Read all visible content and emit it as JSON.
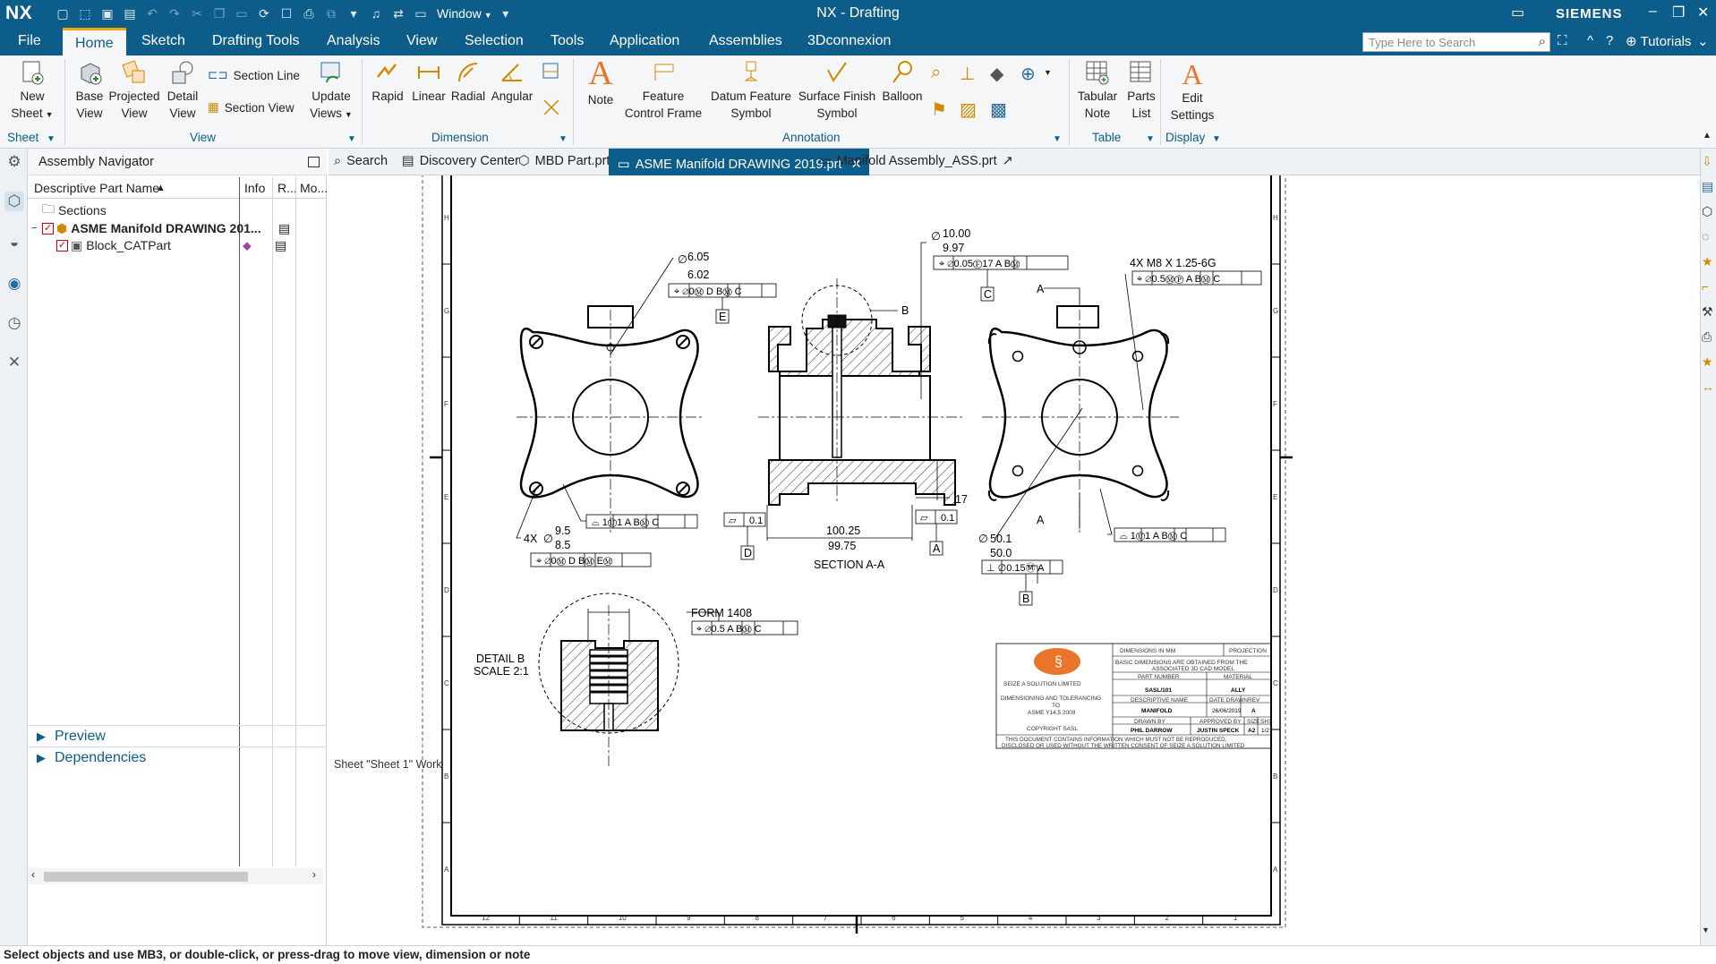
{
  "app": {
    "logo": "NX",
    "window_menu": "Window",
    "title": "NX - Drafting",
    "brand": "SIEMENS"
  },
  "ribbon_tabs": [
    "File",
    "Home",
    "Sketch",
    "Drafting Tools",
    "Analysis",
    "View",
    "Selection",
    "Tools",
    "Application",
    "Assemblies",
    "3Dconnexion"
  ],
  "search": {
    "placeholder": "Type Here to Search"
  },
  "tutorials": "Tutorials",
  "ribbon": {
    "sheet": {
      "new_sheet_1": "New",
      "new_sheet_2": "Sheet",
      "group": "Sheet"
    },
    "view": {
      "base_1": "Base",
      "base_2": "View",
      "projected_1": "Projected",
      "projected_2": "View",
      "detail_1": "Detail",
      "detail_2": "View",
      "section_line": "Section Line",
      "section_view": "Section View",
      "update_1": "Update",
      "update_2": "Views",
      "group": "View"
    },
    "dimension": {
      "rapid": "Rapid",
      "linear": "Linear",
      "radial": "Radial",
      "angular": "Angular",
      "group": "Dimension"
    },
    "annotation": {
      "note": "Note",
      "fcf_1": "Feature",
      "fcf_2": "Control Frame",
      "datum_1": "Datum Feature",
      "datum_2": "Symbol",
      "surface_1": "Surface Finish",
      "surface_2": "Symbol",
      "balloon": "Balloon",
      "group": "Annotation"
    },
    "table": {
      "tabular_1": "Tabular",
      "tabular_2": "Note",
      "parts_1": "Parts",
      "parts_2": "List",
      "group": "Table"
    },
    "display": {
      "edit_1": "Edit",
      "edit_2": "Settings",
      "group": "Display"
    }
  },
  "navigator": {
    "title": "Assembly Navigator",
    "columns": [
      "Descriptive Part Name",
      "Info",
      "R...",
      "Mo..."
    ],
    "rows": [
      {
        "name": "Sections"
      },
      {
        "name": "ASME Manifold DRAWING 201..."
      },
      {
        "name": "Block_CATPart"
      }
    ],
    "preview": "Preview",
    "dependencies": "Dependencies"
  },
  "doc_tabs": [
    {
      "label": "Search"
    },
    {
      "label": "Discovery Center"
    },
    {
      "label": "MBD Part.prt"
    },
    {
      "label": "ASME Manifold DRAWING 2019.prt",
      "active": true
    },
    {
      "label": "Manifold Assembly_ASS.prt"
    }
  ],
  "drawing": {
    "zone_numbers": [
      "12",
      "11",
      "10",
      "9",
      "8",
      "7",
      "6",
      "5",
      "4",
      "3",
      "2",
      "1"
    ],
    "zone_letters": [
      "H",
      "G",
      "F",
      "E",
      "D",
      "C",
      "B",
      "A"
    ],
    "sheet_label": "Sheet \"Sheet 1\" Work",
    "annotations": {
      "d605": "6.05",
      "d602": "6.02",
      "d1000": "10.00",
      "d997": "9.97",
      "thread": "4X  M8 X 1.25-6G",
      "B_label": "B",
      "A_label": "A",
      "A_label2": "A",
      "d17": "17",
      "d4x": "4X",
      "d95": "9.5",
      "d85": "8.5",
      "d01": "0.1",
      "d01b": "0.1",
      "d10025": "100.25",
      "d9975": "99.75",
      "section": "SECTION A-A",
      "d501": "50.1",
      "d500": "50.0",
      "form": "FORM 1408",
      "detail1": "DETAIL B",
      "detail2": "SCALE 2:1",
      "fcf_E": "E",
      "fcf_C": "C",
      "fcf_D": "D",
      "fcf_A": "A",
      "fcf_B": "B"
    },
    "title_block": {
      "company": "SEIZE A SOLUTION LIMITED",
      "desc1": "DIMENSIONING AND TOLERANCING",
      "desc2": "TO",
      "desc3": "ASME Y14.5 2009",
      "copyright": "COPYRIGHT SASL",
      "dims": "DIMENSIONS IN MM",
      "projection": "PROJECTION",
      "basic1": "BASIC DIMENSIONS ARE OBTAINED FROM THE",
      "basic2": "ASSOCIATED 3D CAD MODEL",
      "part_no_lbl": "PART NUMBER",
      "part_no": "SASL/101",
      "material_lbl": "MATERIAL",
      "material": "ALLY",
      "desc_lbl": "DESCRIPTIVE NAME",
      "desc_name": "MANIFOLD",
      "date_lbl": "DATE DRAWN",
      "date": "26/06/2019",
      "rev_lbl": "REV",
      "rev": "A",
      "drawn_lbl": "DRAWN BY",
      "drawn": "PHIL DARROW",
      "approved_lbl": "APPROVED BY",
      "approved": "JUSTIN SPECK",
      "size_lbl": "SIZE",
      "size": "A2",
      "sht_lbl": "SHT",
      "sht": "1/2",
      "notice1": "THIS DOCUMENT CONTAINS INFORMATION WHICH MUST NOT BE REPRODUCED,",
      "notice2": "DISCLOSED OR USED WITHOUT THE WRITTEN CONSENT OF  SEIZE A  SOLUTION LIMITED"
    }
  },
  "status": "Select objects and use MB3, or double-click, or press-drag to move view, dimension or note",
  "colors": {
    "primary": "#0d5d8a",
    "accent": "#f7a600",
    "logo_orange": "#e8752b"
  }
}
